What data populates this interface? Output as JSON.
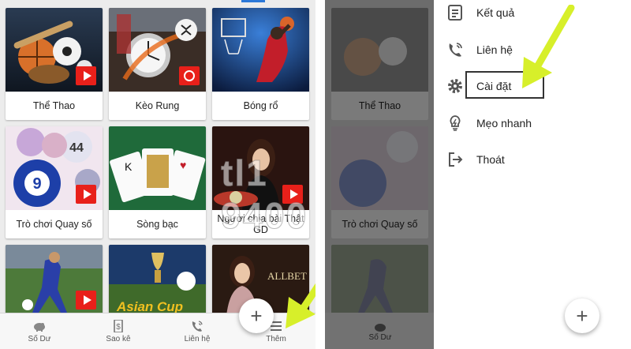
{
  "left": {
    "games": [
      {
        "label": "Thể Thao",
        "badge": "play"
      },
      {
        "label": "Kèo Rung",
        "badge": "timer"
      },
      {
        "label": "Bóng rổ",
        "badge": "none"
      },
      {
        "label": "Trò chơi Quay số",
        "badge": "play"
      },
      {
        "label": "Sòng bạc",
        "badge": "none"
      },
      {
        "label": "Người chia bài Thật GD",
        "badge": "none"
      },
      {
        "label": "",
        "badge": "play"
      },
      {
        "label": "",
        "badge": "none"
      },
      {
        "label": "",
        "badge": "none"
      }
    ],
    "watermark": "tl1    9400",
    "thumb_text": {
      "asian_cup": "Asian Cup",
      "allbet": "ALLBET"
    },
    "fab_label": "+",
    "nav": [
      {
        "label": "Số Dư",
        "icon": "piggy-bank-icon"
      },
      {
        "label": "Sao kê",
        "icon": "statement-icon"
      },
      {
        "label": "Liên hệ",
        "icon": "phone-icon"
      },
      {
        "label": "Thêm",
        "icon": "menu-icon"
      }
    ]
  },
  "right": {
    "ghost_labels": [
      "Thể Thao",
      "Trò chơi Quay số"
    ],
    "ghost_nav_label": "Số Dư",
    "menu": [
      {
        "label": "Kết quả",
        "icon": "results-icon"
      },
      {
        "label": "Liên hệ",
        "icon": "phone-icon"
      },
      {
        "label": "Cài đặt",
        "icon": "gear-icon"
      },
      {
        "label": "Mẹo nhanh",
        "icon": "lightbulb-icon"
      },
      {
        "label": "Thoát",
        "icon": "logout-icon"
      }
    ],
    "fab_label": "+"
  },
  "colors": {
    "accent": "#2c78d8",
    "badge_red": "#e8201a",
    "arrow_yellow": "#d7ef2a"
  }
}
